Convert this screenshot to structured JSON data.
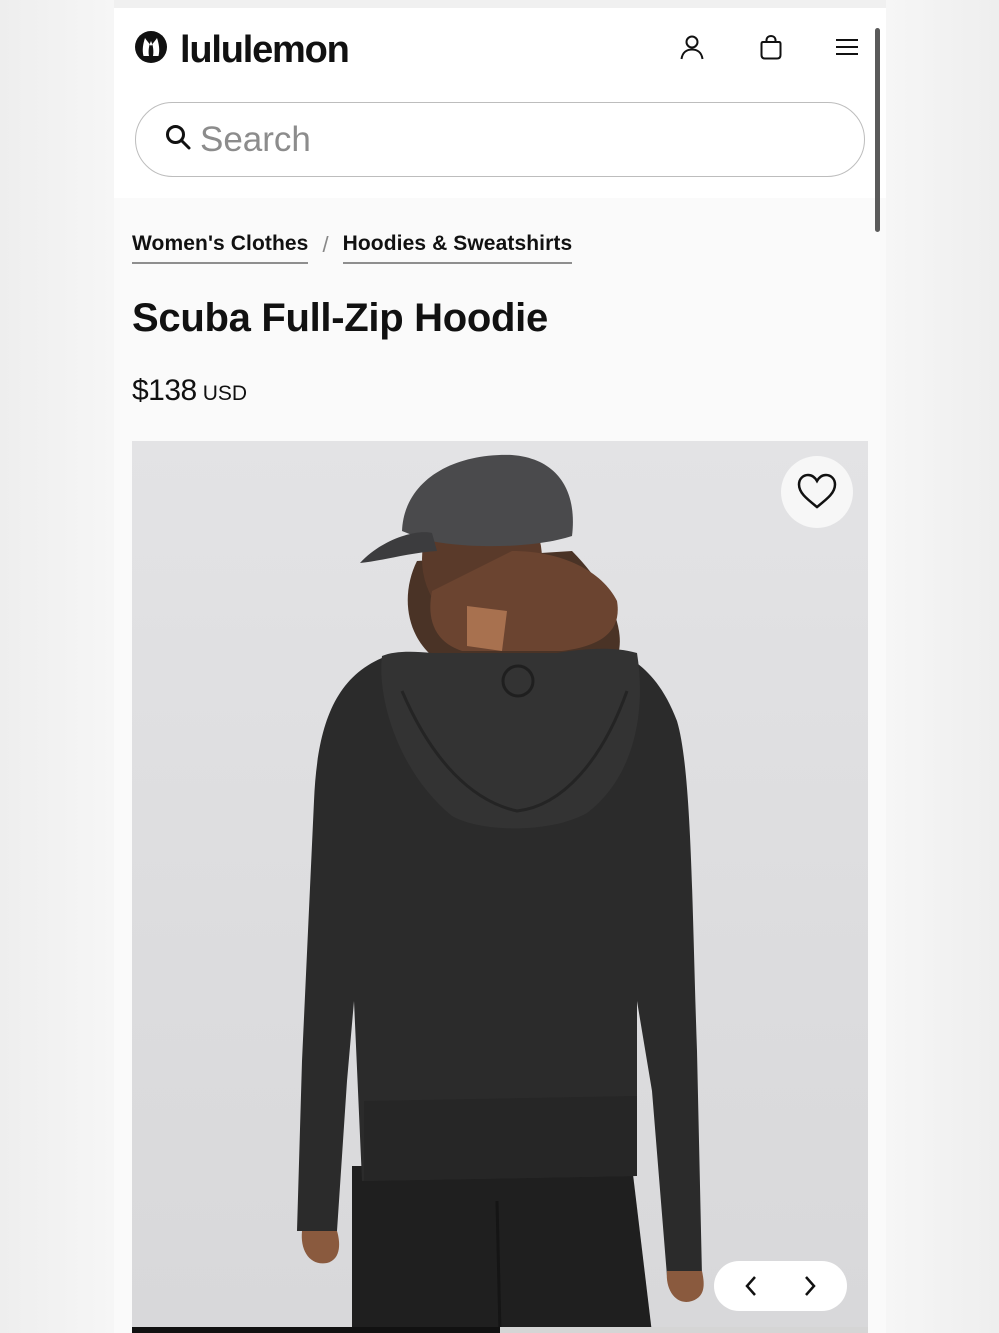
{
  "header": {
    "brand": "lululemon",
    "icons": [
      "lululemon-logo-icon",
      "account-icon",
      "shopping-bag-icon",
      "menu-icon"
    ]
  },
  "search": {
    "placeholder": "Search",
    "value": ""
  },
  "breadcrumb": {
    "items": [
      {
        "label": "Women's Clothes"
      },
      {
        "label": "Hoodies & Sweatshirts"
      }
    ],
    "separator": "/"
  },
  "product": {
    "title": "Scuba Full-Zip Hoodie",
    "price": "$138",
    "currency": "USD"
  },
  "gallery": {
    "image_progress": 0.5
  },
  "colors": {
    "text": "#111111",
    "search_border": "#bdbdbd",
    "placeholder": "#8c8c8c",
    "image_bg": "#e0e0e2",
    "hoodie": "#2b2b2b"
  }
}
